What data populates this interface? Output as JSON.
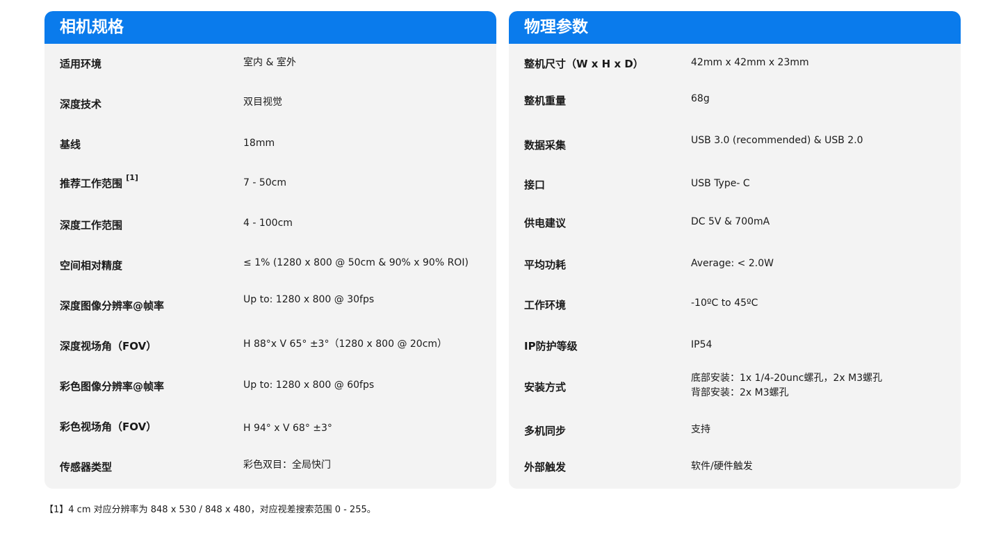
{
  "left": {
    "title": "相机规格",
    "rows": [
      {
        "label": "适用环境",
        "sup": "",
        "value": "室内 & 室外"
      },
      {
        "label": "深度技术",
        "sup": "",
        "value": "双目视觉"
      },
      {
        "label": "基线",
        "sup": "",
        "value": "18mm"
      },
      {
        "label": "推荐工作范围",
        "sup": "[1]",
        "value": "7 - 50cm"
      },
      {
        "label": "深度工作范围",
        "sup": "",
        "value": "4 - 100cm"
      },
      {
        "label": "空间相对精度",
        "sup": "",
        "value": "≤ 1% (1280 x 800 @ 50cm & 90% x 90% ROI)"
      },
      {
        "label": "深度图像分辨率@帧率",
        "sup": "",
        "value": "Up to: 1280 x 800 @ 30fps"
      },
      {
        "label": "深度视场角（FOV）",
        "sup": "",
        "value": "H 88°x V 65° ±3°（1280 x 800 @ 20cm）"
      },
      {
        "label": "彩色图像分辨率@帧率",
        "sup": "",
        "value": "Up to: 1280 x 800 @ 60fps"
      },
      {
        "label": "彩色视场角（FOV）",
        "sup": "",
        "value": "H 94° x V 68° ±3°"
      },
      {
        "label": "传感器类型",
        "sup": "",
        "value": "彩色双目：全局快门"
      }
    ]
  },
  "right": {
    "title": "物理参数",
    "rows": [
      {
        "label": "整机尺寸（W x H x D）",
        "value": "42mm x 42mm x 23mm",
        "value2": ""
      },
      {
        "label": "整机重量",
        "value": "68g",
        "value2": ""
      },
      {
        "label": "数据采集",
        "value": "USB 3.0 (recommended) & USB 2.0",
        "value2": ""
      },
      {
        "label": "接口",
        "value": "USB Type- C",
        "value2": ""
      },
      {
        "label": "供电建议",
        "value": "DC 5V & 700mA",
        "value2": ""
      },
      {
        "label": "平均功耗",
        "value": "Average: < 2.0W",
        "value2": ""
      },
      {
        "label": "工作环境",
        "value": "-10ºC to 45ºC",
        "value2": ""
      },
      {
        "label": "IP防护等级",
        "value": "IP54",
        "value2": ""
      },
      {
        "label": "安装方式",
        "value": "底部安装：1x 1/4-20unc螺孔，2x M3螺孔",
        "value2": "背部安装：2x M3螺孔"
      },
      {
        "label": "多机同步",
        "value": "支持",
        "value2": ""
      },
      {
        "label": "外部触发",
        "value": "软件/硬件触发",
        "value2": ""
      }
    ]
  },
  "footnote": "【1】4 cm 对应分辨率为 848 x 530 / 848 x 480，对应视差搜索范围 0 - 255。"
}
